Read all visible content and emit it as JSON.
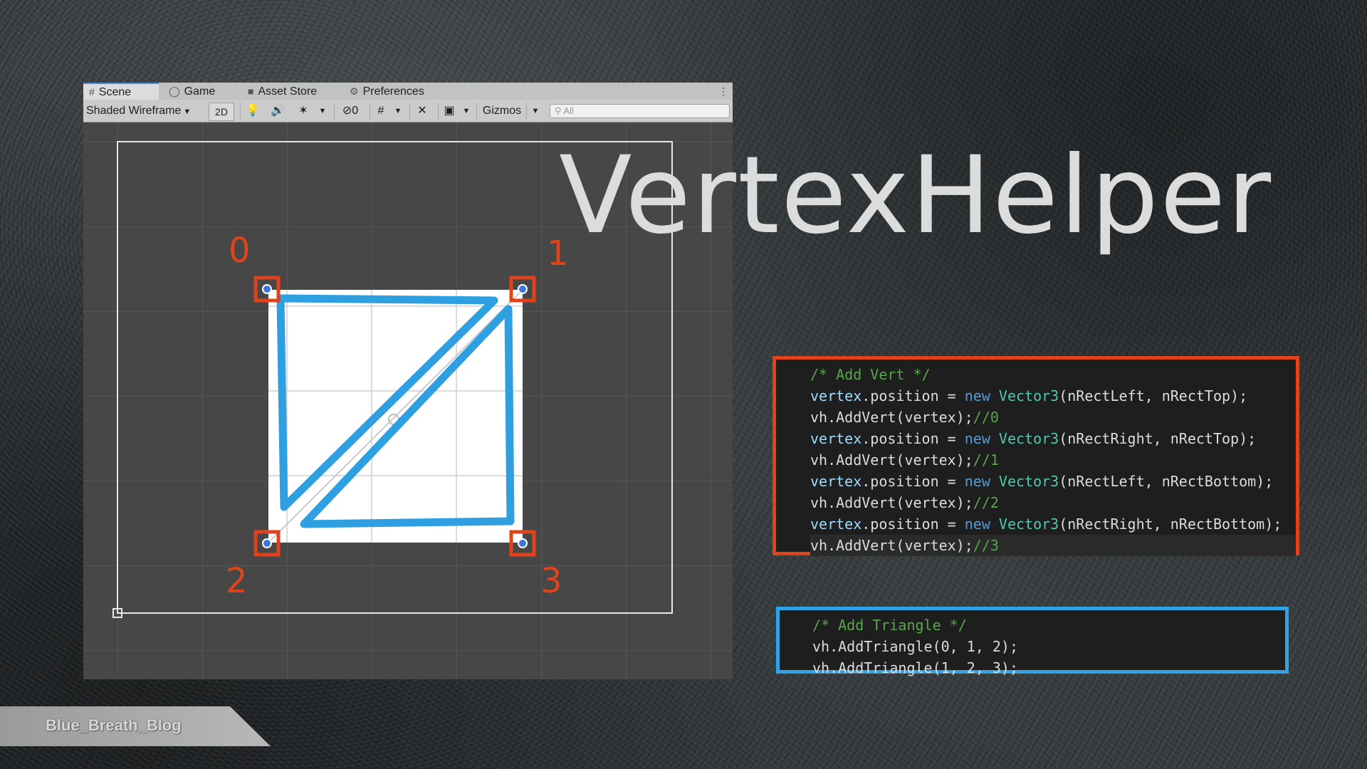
{
  "tabs": [
    {
      "label": "Scene",
      "icon": "grid-icon",
      "active": true
    },
    {
      "label": "Game",
      "icon": "gamepad-icon",
      "active": false
    },
    {
      "label": "Asset Store",
      "icon": "bag-icon",
      "active": false
    },
    {
      "label": "Preferences",
      "icon": "gear-icon",
      "active": false
    }
  ],
  "toolbar": {
    "shading_mode": "Shaded Wireframe",
    "mode_2d": "2D",
    "hidden_count": "0",
    "gizmos": "Gizmos",
    "search_placeholder": "All"
  },
  "vertex_labels": [
    "0",
    "1",
    "2",
    "3"
  ],
  "title": "VertexHelper",
  "code_vert": {
    "comment": "/* Add Vert */",
    "lines": [
      {
        "obj": "vertex",
        "prop": ".position = ",
        "kw": "new",
        "type": "Vector3",
        "args": "(nRectLeft, nRectTop);"
      },
      {
        "call": "vh.AddVert(vertex);",
        "comment": "//0"
      },
      {
        "obj": "vertex",
        "prop": ".position = ",
        "kw": "new",
        "type": "Vector3",
        "args": "(nRectRight, nRectTop);"
      },
      {
        "call": "vh.AddVert(vertex);",
        "comment": "//1"
      },
      {
        "obj": "vertex",
        "prop": ".position = ",
        "kw": "new",
        "type": "Vector3",
        "args": "(nRectLeft, nRectBottom);"
      },
      {
        "call": "vh.AddVert(vertex);",
        "comment": "//2"
      },
      {
        "obj": "vertex",
        "prop": ".position = ",
        "kw": "new",
        "type": "Vector3",
        "args": "(nRectRight, nRectBottom);"
      },
      {
        "call": "vh.AddVert(vertex);",
        "comment": "//3"
      }
    ]
  },
  "code_tri": {
    "comment": "/* Add Triangle */",
    "lines": [
      "vh.AddTriangle(0, 1, 2);",
      "vh.AddTriangle(1, 2, 3);"
    ]
  },
  "watermark": "Blue_Breath_Blog",
  "colors": {
    "highlight_red": "#e0421a",
    "highlight_blue": "#2ea3e8",
    "stroke_blue": "#2e9fe0"
  }
}
